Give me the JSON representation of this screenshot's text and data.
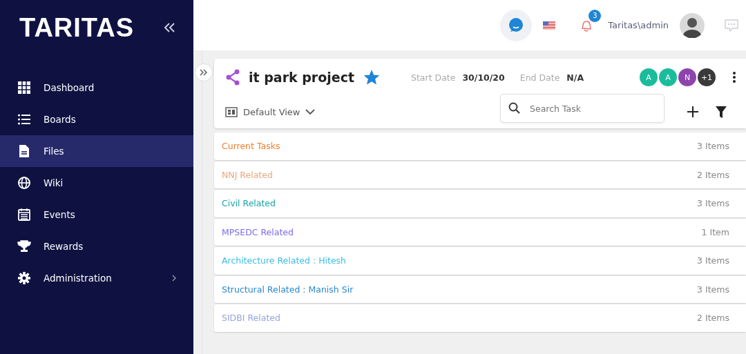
{
  "sidebar": {
    "logo": "TARITAS",
    "items": [
      {
        "label": "Dashboard",
        "kind": "grid",
        "selected": false,
        "has_submenu": false
      },
      {
        "label": "Boards",
        "kind": "list",
        "selected": false,
        "has_submenu": false
      },
      {
        "label": "Files",
        "kind": "file",
        "selected": true,
        "has_submenu": false
      },
      {
        "label": "Wiki",
        "kind": "globe",
        "selected": false,
        "has_submenu": false
      },
      {
        "label": "Events",
        "kind": "calendar",
        "selected": false,
        "has_submenu": false
      },
      {
        "label": "Rewards",
        "kind": "trophy",
        "selected": false,
        "has_submenu": false
      },
      {
        "label": "Administration",
        "kind": "gear",
        "selected": false,
        "has_submenu": true
      }
    ]
  },
  "topbar": {
    "notification_count": "3",
    "user": "Taritas\\admin"
  },
  "project": {
    "title": "it park project",
    "starred": true,
    "start_label": "Start Date",
    "start_date": "30/10/20",
    "end_label": "End Date",
    "end_date": "N/A",
    "members": [
      {
        "initials": "A",
        "color": "#1abc9c"
      },
      {
        "initials": "A",
        "color": "#1abc9c"
      },
      {
        "initials": "N",
        "color": "#8e44ad"
      },
      {
        "initials": "+1",
        "color": "#3a3a3a"
      }
    ],
    "view": "Default View",
    "search": {
      "placeholder": "Search Task"
    }
  },
  "folders": [
    {
      "name": "Current Tasks",
      "count": "3 Items",
      "color": "#f57c2b"
    },
    {
      "name": "NNJ Related",
      "count": "2 Items",
      "color": "#eaa77d"
    },
    {
      "name": "Civil Related",
      "count": "3 Items",
      "color": "#1ba3a8"
    },
    {
      "name": "MPSEDC Related",
      "count": "1 Item",
      "color": "#7b6cf0"
    },
    {
      "name": "Architecture Related : Hitesh",
      "count": "3 Items",
      "color": "#3bbde6"
    },
    {
      "name": "Structural Related : Manish Sir",
      "count": "3 Items",
      "color": "#2a86d1"
    },
    {
      "name": "SIDBI Related",
      "count": "2 Items",
      "color": "#95a4dc"
    }
  ]
}
